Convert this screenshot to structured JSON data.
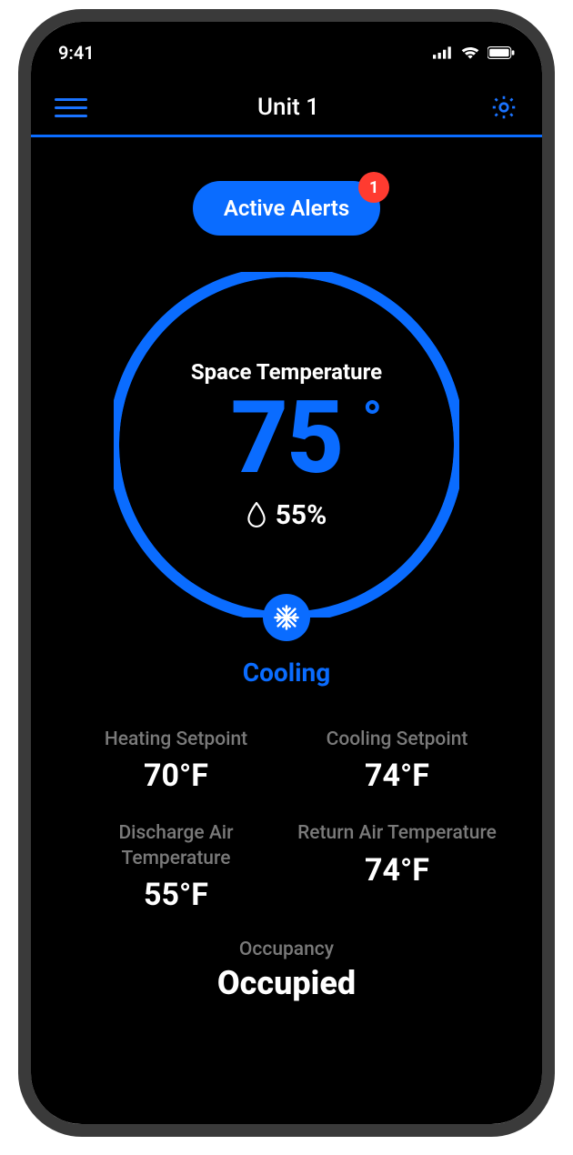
{
  "status": {
    "time": "9:41"
  },
  "nav": {
    "title": "Unit 1"
  },
  "alerts": {
    "label": "Active Alerts",
    "count": "1"
  },
  "dial": {
    "label": "Space Temperature",
    "temp": "75",
    "degree": "°",
    "humidity": "55%",
    "mode": "Cooling"
  },
  "stats": {
    "heating_setpoint": {
      "label": "Heating Setpoint",
      "value": "70°F"
    },
    "cooling_setpoint": {
      "label": "Cooling Setpoint",
      "value": "74°F"
    },
    "discharge_air": {
      "label": "Discharge Air Temperature",
      "value": "55°F"
    },
    "return_air": {
      "label": "Return Air Temperature",
      "value": "74°F"
    }
  },
  "occupancy": {
    "label": "Occupancy",
    "value": "Occupied"
  },
  "colors": {
    "accent": "#0a6cff",
    "badge": "#ff3b30"
  }
}
